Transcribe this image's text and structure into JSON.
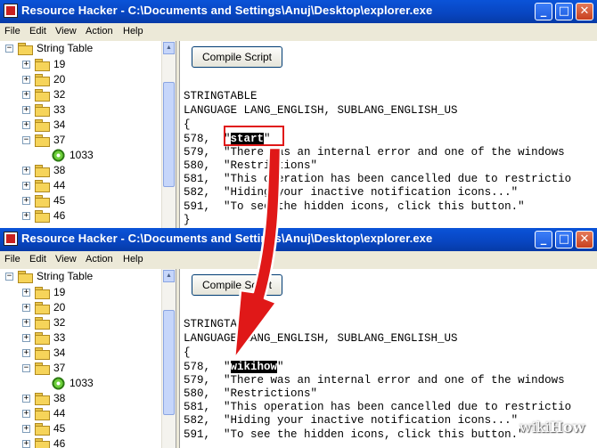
{
  "app_window_title": "Resource Hacker",
  "window_path": "C:\\Documents and Settings\\Anuj\\Desktop\\explorer.exe",
  "title_separator": "-",
  "menu": [
    "File",
    "Edit",
    "View",
    "Action",
    "Help"
  ],
  "title_buttons": {
    "minimize": "_",
    "maximize": "□",
    "close": "✕"
  },
  "tree": {
    "root_label": "String Table",
    "items": [
      "19",
      "20",
      "32",
      "33",
      "34",
      "37",
      "38",
      "44",
      "45",
      "46"
    ],
    "expanded_item": "37",
    "child_item": "1033",
    "expander_plus": "+",
    "expander_minus": "−"
  },
  "compile_button": "Compile Script",
  "code": {
    "header": [
      "STRINGTABLE",
      "LANGUAGE LANG_ENGLISH, SUBLANG_ENGLISH_US",
      "{"
    ],
    "ids": [
      "578,",
      "579,",
      "580,",
      "581,",
      "582,",
      "591,"
    ],
    "strings": [
      "\"There was an internal error and one of the windows",
      "\"Restrictions\"",
      "\"This operation has been cancelled due to restrictio",
      "\"Hiding your inactive notification icons...\"",
      "\"To see the hidden icons, click this button.\""
    ],
    "closing": "}"
  },
  "windows": [
    {
      "first_string_value": "start"
    },
    {
      "first_string_value": "wikihow"
    }
  ],
  "watermark": {
    "prefix": "wiki",
    "suffix": "How"
  },
  "colors": {
    "titlebar": "#0845c0",
    "selection": "#316ac5",
    "highlight_box": "#e01818",
    "arrow": "#e01818"
  }
}
